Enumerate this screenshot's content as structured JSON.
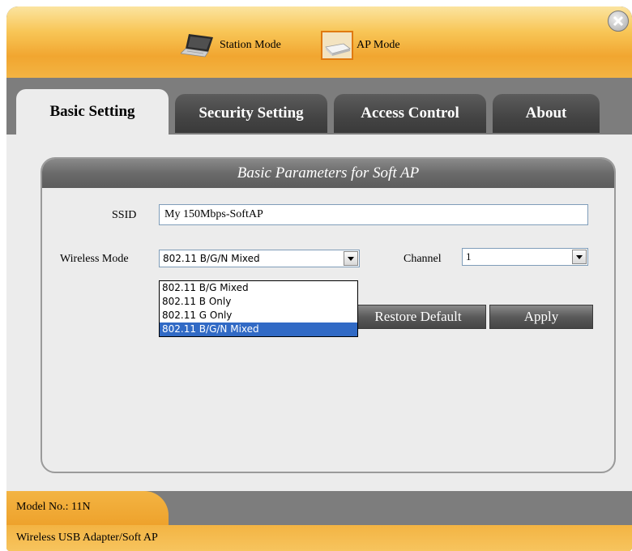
{
  "header": {
    "station_mode_label": "Station Mode",
    "ap_mode_label": "AP Mode",
    "accent_color": "#f1a630"
  },
  "tabs": [
    {
      "label": "Basic Setting",
      "active": true
    },
    {
      "label": "Security Setting",
      "active": false
    },
    {
      "label": "Access Control",
      "active": false
    },
    {
      "label": "About",
      "active": false
    }
  ],
  "panel": {
    "title": "Basic Parameters for Soft AP",
    "ssid_label": "SSID",
    "ssid_value": "My 150Mbps-SoftAP",
    "wireless_mode_label": "Wireless Mode",
    "wireless_mode_value": "802.11 B/G/N Mixed",
    "wireless_mode_options": [
      "802.11 B/G Mixed",
      "802.11 B Only",
      "802.11 G Only",
      "802.11 B/G/N Mixed"
    ],
    "channel_label": "Channel",
    "channel_value": "1",
    "restore_default_label": "Restore Default",
    "apply_label": "Apply"
  },
  "footer": {
    "model_no": "Model No.: 11N",
    "device_description": "Wireless USB Adapter/Soft AP"
  },
  "icons": {
    "station": "laptop-icon",
    "ap": "router-icon",
    "close": "close-icon"
  }
}
